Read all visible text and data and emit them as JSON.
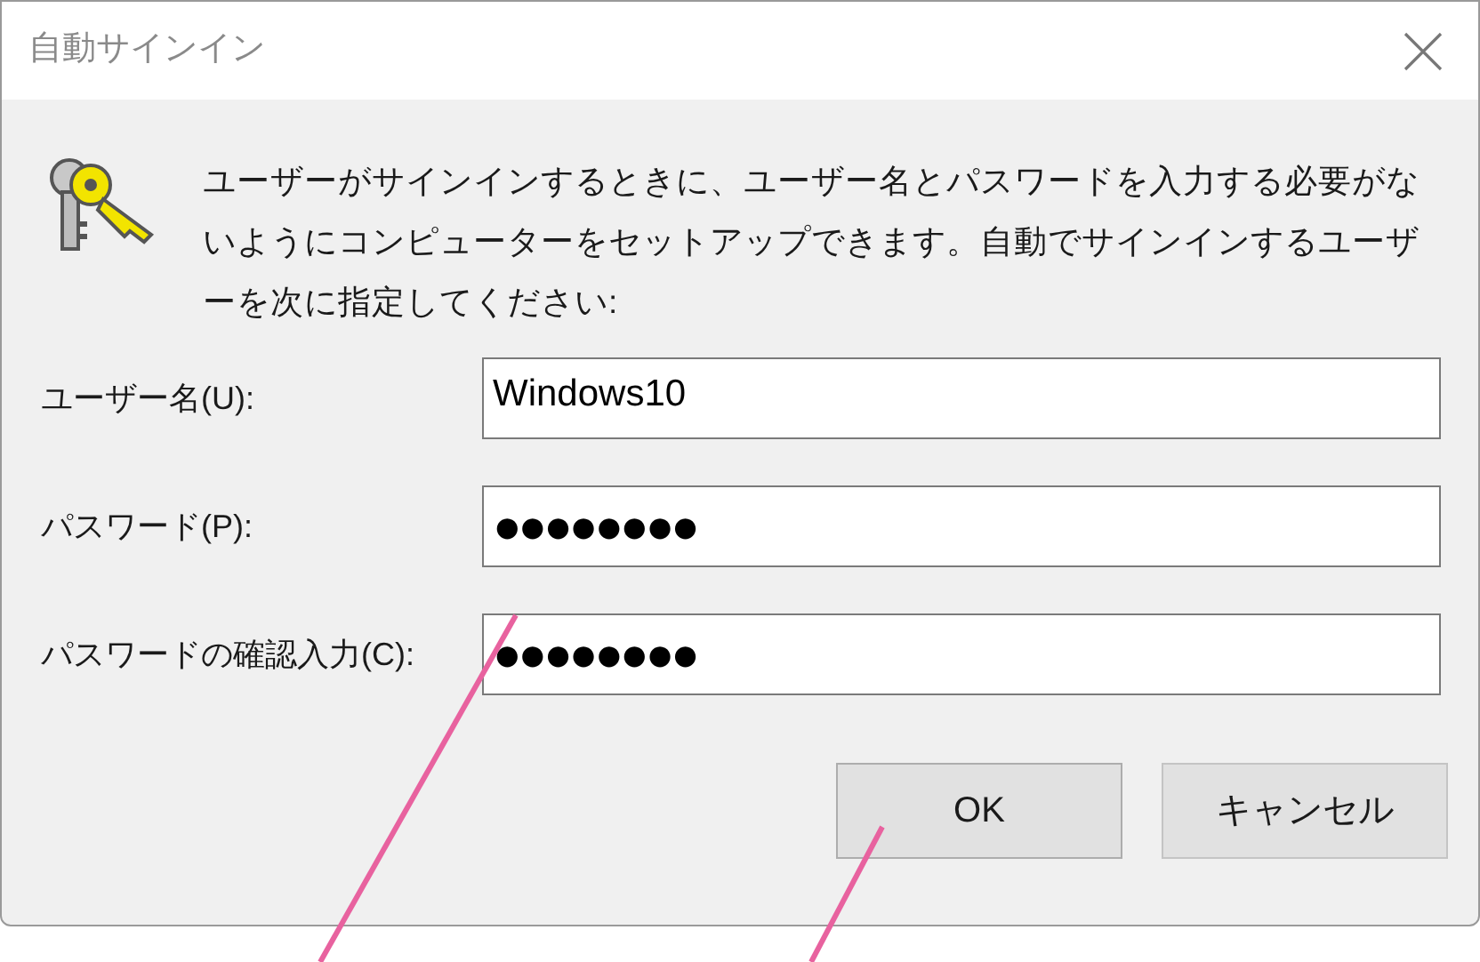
{
  "window": {
    "title": "自動サインイン"
  },
  "description": "ユーザーがサインインするときに、ユーザー名とパスワードを入力する必要がないようにコンピューターをセットアップできます。自動でサインインするユーザーを次に指定してください:",
  "fields": [
    {
      "label": "ユーザー名(U):",
      "value": "Windows10",
      "kind": "text"
    },
    {
      "label": "パスワード(P):",
      "value": "●●●●●●●●",
      "kind": "password"
    },
    {
      "label": "パスワードの確認入力(C):",
      "value": "●●●●●●●●",
      "kind": "password"
    }
  ],
  "buttons": [
    {
      "label": "OK",
      "default": true
    },
    {
      "label": "キャンセル",
      "default": false
    }
  ]
}
